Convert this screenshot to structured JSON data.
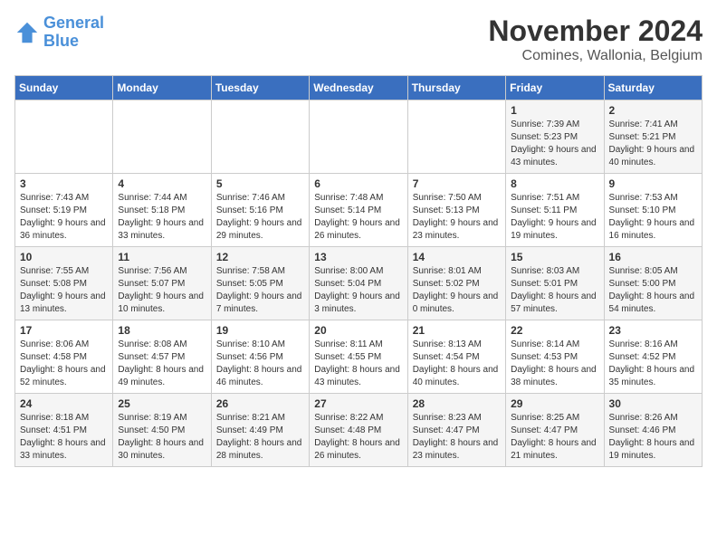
{
  "logo": {
    "line1": "General",
    "line2": "Blue"
  },
  "title": "November 2024",
  "subtitle": "Comines, Wallonia, Belgium",
  "days_of_week": [
    "Sunday",
    "Monday",
    "Tuesday",
    "Wednesday",
    "Thursday",
    "Friday",
    "Saturday"
  ],
  "weeks": [
    [
      {
        "day": "",
        "info": ""
      },
      {
        "day": "",
        "info": ""
      },
      {
        "day": "",
        "info": ""
      },
      {
        "day": "",
        "info": ""
      },
      {
        "day": "",
        "info": ""
      },
      {
        "day": "1",
        "info": "Sunrise: 7:39 AM\nSunset: 5:23 PM\nDaylight: 9 hours and 43 minutes."
      },
      {
        "day": "2",
        "info": "Sunrise: 7:41 AM\nSunset: 5:21 PM\nDaylight: 9 hours and 40 minutes."
      }
    ],
    [
      {
        "day": "3",
        "info": "Sunrise: 7:43 AM\nSunset: 5:19 PM\nDaylight: 9 hours and 36 minutes."
      },
      {
        "day": "4",
        "info": "Sunrise: 7:44 AM\nSunset: 5:18 PM\nDaylight: 9 hours and 33 minutes."
      },
      {
        "day": "5",
        "info": "Sunrise: 7:46 AM\nSunset: 5:16 PM\nDaylight: 9 hours and 29 minutes."
      },
      {
        "day": "6",
        "info": "Sunrise: 7:48 AM\nSunset: 5:14 PM\nDaylight: 9 hours and 26 minutes."
      },
      {
        "day": "7",
        "info": "Sunrise: 7:50 AM\nSunset: 5:13 PM\nDaylight: 9 hours and 23 minutes."
      },
      {
        "day": "8",
        "info": "Sunrise: 7:51 AM\nSunset: 5:11 PM\nDaylight: 9 hours and 19 minutes."
      },
      {
        "day": "9",
        "info": "Sunrise: 7:53 AM\nSunset: 5:10 PM\nDaylight: 9 hours and 16 minutes."
      }
    ],
    [
      {
        "day": "10",
        "info": "Sunrise: 7:55 AM\nSunset: 5:08 PM\nDaylight: 9 hours and 13 minutes."
      },
      {
        "day": "11",
        "info": "Sunrise: 7:56 AM\nSunset: 5:07 PM\nDaylight: 9 hours and 10 minutes."
      },
      {
        "day": "12",
        "info": "Sunrise: 7:58 AM\nSunset: 5:05 PM\nDaylight: 9 hours and 7 minutes."
      },
      {
        "day": "13",
        "info": "Sunrise: 8:00 AM\nSunset: 5:04 PM\nDaylight: 9 hours and 3 minutes."
      },
      {
        "day": "14",
        "info": "Sunrise: 8:01 AM\nSunset: 5:02 PM\nDaylight: 9 hours and 0 minutes."
      },
      {
        "day": "15",
        "info": "Sunrise: 8:03 AM\nSunset: 5:01 PM\nDaylight: 8 hours and 57 minutes."
      },
      {
        "day": "16",
        "info": "Sunrise: 8:05 AM\nSunset: 5:00 PM\nDaylight: 8 hours and 54 minutes."
      }
    ],
    [
      {
        "day": "17",
        "info": "Sunrise: 8:06 AM\nSunset: 4:58 PM\nDaylight: 8 hours and 52 minutes."
      },
      {
        "day": "18",
        "info": "Sunrise: 8:08 AM\nSunset: 4:57 PM\nDaylight: 8 hours and 49 minutes."
      },
      {
        "day": "19",
        "info": "Sunrise: 8:10 AM\nSunset: 4:56 PM\nDaylight: 8 hours and 46 minutes."
      },
      {
        "day": "20",
        "info": "Sunrise: 8:11 AM\nSunset: 4:55 PM\nDaylight: 8 hours and 43 minutes."
      },
      {
        "day": "21",
        "info": "Sunrise: 8:13 AM\nSunset: 4:54 PM\nDaylight: 8 hours and 40 minutes."
      },
      {
        "day": "22",
        "info": "Sunrise: 8:14 AM\nSunset: 4:53 PM\nDaylight: 8 hours and 38 minutes."
      },
      {
        "day": "23",
        "info": "Sunrise: 8:16 AM\nSunset: 4:52 PM\nDaylight: 8 hours and 35 minutes."
      }
    ],
    [
      {
        "day": "24",
        "info": "Sunrise: 8:18 AM\nSunset: 4:51 PM\nDaylight: 8 hours and 33 minutes."
      },
      {
        "day": "25",
        "info": "Sunrise: 8:19 AM\nSunset: 4:50 PM\nDaylight: 8 hours and 30 minutes."
      },
      {
        "day": "26",
        "info": "Sunrise: 8:21 AM\nSunset: 4:49 PM\nDaylight: 8 hours and 28 minutes."
      },
      {
        "day": "27",
        "info": "Sunrise: 8:22 AM\nSunset: 4:48 PM\nDaylight: 8 hours and 26 minutes."
      },
      {
        "day": "28",
        "info": "Sunrise: 8:23 AM\nSunset: 4:47 PM\nDaylight: 8 hours and 23 minutes."
      },
      {
        "day": "29",
        "info": "Sunrise: 8:25 AM\nSunset: 4:47 PM\nDaylight: 8 hours and 21 minutes."
      },
      {
        "day": "30",
        "info": "Sunrise: 8:26 AM\nSunset: 4:46 PM\nDaylight: 8 hours and 19 minutes."
      }
    ]
  ]
}
